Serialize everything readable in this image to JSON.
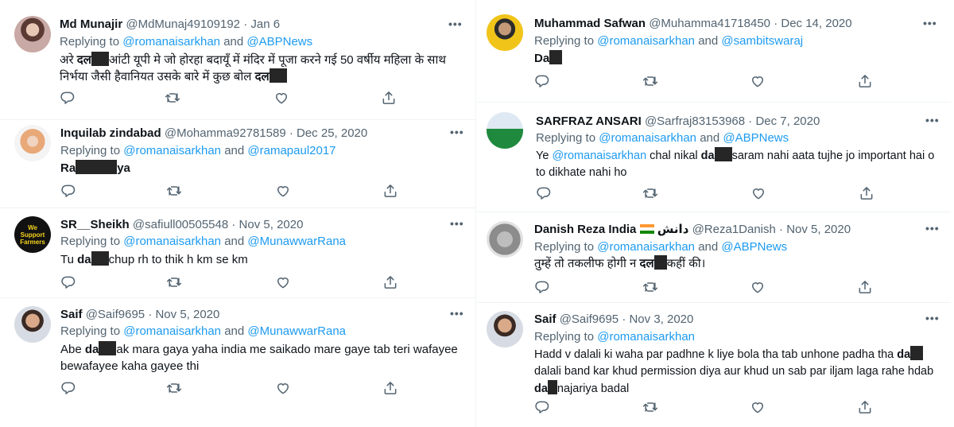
{
  "icons": [
    "reply-icon",
    "retweet-icon",
    "like-icon",
    "share-icon",
    "more-icon",
    "india-flag-icon"
  ],
  "colors": {
    "link": "#1d9bf0",
    "secondary": "#536471",
    "text": "#0f1419",
    "redaction": "#262626"
  },
  "replying_prefix": "Replying to",
  "and_word": "and",
  "more_glyph": "•••",
  "left": [
    {
      "name": "Md Munajir",
      "handle": "@MdMunaj49109192",
      "date": "· Jan 6",
      "mentions": [
        "@romanaisarkhan",
        "@ABPNews"
      ],
      "text_a": "अरे ",
      "bold_a": "दल",
      "text_b": "आंटी यूपी मे जो होरहा बदायूँ में मंदिर में पूजा करने गई 50 वर्षीय महिला के साथ निर्भया जैसी हैवानियत उसके बारे में कुछ बोल ",
      "bold_b": "दल"
    },
    {
      "name": "Inquilab zindabad",
      "handle": "@Mohamma92781589",
      "date": "· Dec 25, 2020",
      "mentions": [
        "@romanaisarkhan",
        "@ramapaul2017"
      ],
      "bold_a": "Ra",
      "bold_b": "ya"
    },
    {
      "name": "SR__Sheikh",
      "handle": "@safiull00505548",
      "date": "· Nov 5, 2020",
      "mentions": [
        "@romanaisarkhan",
        "@MunawwarRana"
      ],
      "avatar_text": "We Support Farmers",
      "text_a": "Tu ",
      "bold_a": "da",
      "text_b": "chup rh to thik h km se km"
    },
    {
      "name": "Saif",
      "handle": "@Saif9695",
      "date": "· Nov 5, 2020",
      "mentions": [
        "@romanaisarkhan",
        "@MunawwarRana"
      ],
      "text_a": "Abe ",
      "bold_a": "da",
      "text_b": "ak mara gaya  yaha india me saikado mare gaye tab teri wafayee bewafayee  kaha gayee thi"
    }
  ],
  "right": [
    {
      "name": "Muhammad Safwan",
      "handle": "@Muhamma41718450",
      "date": "· Dec 14, 2020",
      "mentions": [
        "@romanaisarkhan",
        "@sambitswaraj"
      ],
      "bold_a": "Da"
    },
    {
      "name": "SARFRAZ ANSARI",
      "handle": "@Sarfraj83153968",
      "date": "· Dec 7, 2020",
      "mentions": [
        "@romanaisarkhan",
        "@ABPNews"
      ],
      "text_a": "Ye ",
      "inline_mention": "@romanaisarkhan",
      "text_b": " chal nikal ",
      "bold_a": "da",
      "text_c": "saram nahi aata tujhe jo important hai o to dikhate nahi ho"
    },
    {
      "name": "Danish Reza India",
      "name_suffix": "دانش",
      "handle": "@Reza1Danish",
      "date": "· Nov 5, 2020",
      "mentions": [
        "@romanaisarkhan",
        "@ABPNews"
      ],
      "text_a": "तुम्हें तो तकलीफ होगी न ",
      "bold_a": "दल",
      "text_b": "कहीं की।"
    },
    {
      "name": "Saif",
      "handle": "@Saif9695",
      "date": "· Nov 3, 2020",
      "mentions": [
        "@romanaisarkhan"
      ],
      "text_a": "Hadd v dalali ki waha par padhne k liye bola tha tab unhone padha tha ",
      "bold_a": "da",
      "text_b": "dalali band kar khud permission diya aur khud un sab par iljam laga rahe hdab ",
      "bold_b": "da",
      "text_c": "najariya badal"
    }
  ]
}
